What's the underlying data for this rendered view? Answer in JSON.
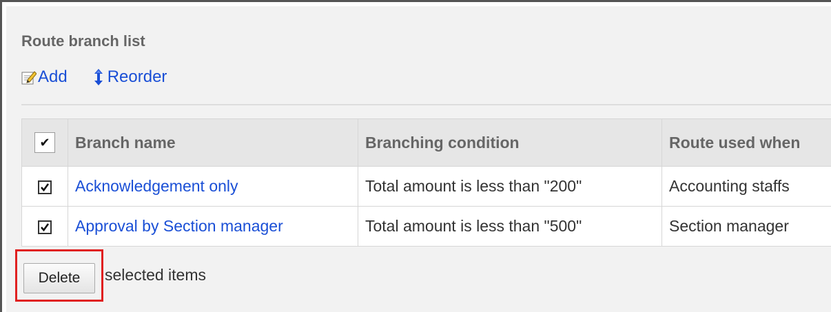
{
  "section": {
    "title": "Route branch list"
  },
  "toolbar": {
    "add_label": "Add",
    "add_icon": "edit-note-icon",
    "reorder_label": "Reorder",
    "reorder_icon": "up-down-arrows-icon"
  },
  "table": {
    "columns": [
      "Branch name",
      "Branching condition",
      "Route used when"
    ],
    "header_checkbox": "✔",
    "rows": [
      {
        "checked": true,
        "branch_name": "Acknowledgement only",
        "condition": "Total amount is less than \"200\"",
        "route": "Accounting staffs"
      },
      {
        "checked": true,
        "branch_name": "Approval by Section manager",
        "condition": "Total amount is less than \"500\"",
        "route": "Section manager"
      }
    ]
  },
  "bulk_action": {
    "delete_label": "Delete",
    "suffix": "selected items"
  },
  "colors": {
    "link": "#1a4fd6",
    "highlight": "#e02020",
    "panel_background": "#f2f2f2",
    "header_background": "#e6e6e6"
  }
}
